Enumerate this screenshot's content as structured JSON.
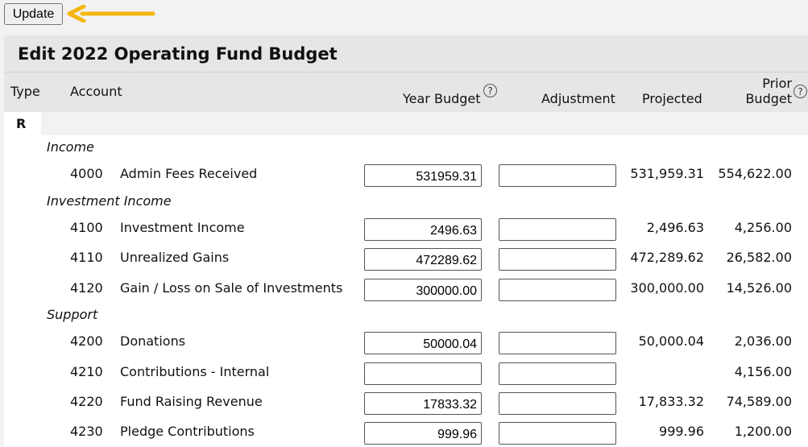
{
  "toolbar": {
    "update_label": "Update",
    "arrow_color": "#f5b60f"
  },
  "panel": {
    "title": "Edit 2022 Operating Fund Budget",
    "columns": {
      "type": "Type",
      "account": "Account",
      "year_budget": "Year Budget",
      "adjustment": "Adjustment",
      "projected": "Projected",
      "prior_line1": "Prior",
      "prior_line2": "Budget",
      "help_glyph": "?"
    },
    "record_type": "R",
    "groups": [
      {
        "label": "Income",
        "rows": [
          {
            "code": "4000",
            "name": "Admin Fees Received",
            "year_budget": "531959.31",
            "adjustment": "",
            "projected": "531,959.31",
            "prior": "554,622.00"
          }
        ]
      },
      {
        "label": "Investment Income",
        "rows": [
          {
            "code": "4100",
            "name": "Investment Income",
            "year_budget": "2496.63",
            "adjustment": "",
            "projected": "2,496.63",
            "prior": "4,256.00"
          },
          {
            "code": "4110",
            "name": "Unrealized Gains",
            "year_budget": "472289.62",
            "adjustment": "",
            "projected": "472,289.62",
            "prior": "26,582.00"
          },
          {
            "code": "4120",
            "name": "Gain / Loss on Sale of Investments",
            "year_budget": "300000.00",
            "adjustment": "",
            "projected": "300,000.00",
            "prior": "14,526.00"
          }
        ]
      },
      {
        "label": "Support",
        "rows": [
          {
            "code": "4200",
            "name": "Donations",
            "year_budget": "50000.04",
            "adjustment": "",
            "projected": "50,000.04",
            "prior": "2,036.00"
          },
          {
            "code": "4210",
            "name": "Contributions - Internal",
            "year_budget": "",
            "adjustment": "",
            "projected": "",
            "prior": "4,156.00"
          },
          {
            "code": "4220",
            "name": "Fund Raising Revenue",
            "year_budget": "17833.32",
            "adjustment": "",
            "projected": "17,833.32",
            "prior": "74,589.00"
          },
          {
            "code": "4230",
            "name": "Pledge Contributions",
            "year_budget": "999.96",
            "adjustment": "",
            "projected": "999.96",
            "prior": "1,200.00"
          }
        ]
      }
    ]
  }
}
